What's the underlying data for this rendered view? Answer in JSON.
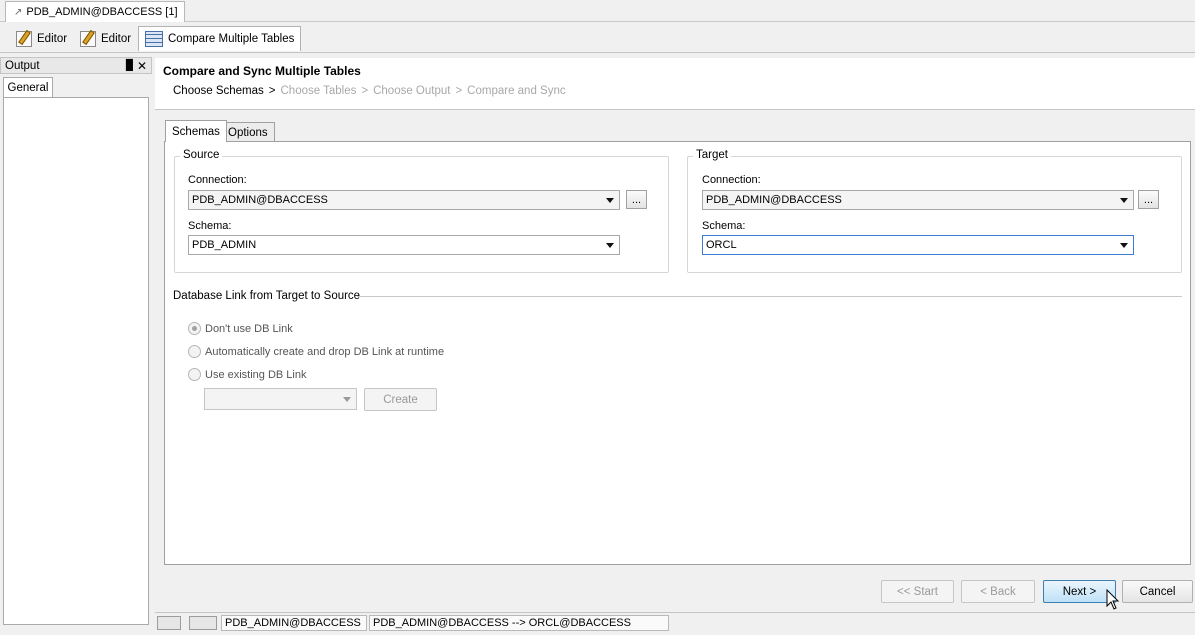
{
  "connection_tab": {
    "label": "PDB_ADMIN@DBACCESS [1]"
  },
  "editor_tabs": [
    {
      "label": "Editor",
      "icon": "edit-icon"
    },
    {
      "label": "Editor",
      "icon": "edit-icon"
    },
    {
      "label": "Compare Multiple Tables",
      "icon": "compare-tables-icon"
    }
  ],
  "output_panel": {
    "title": "Output",
    "tab": "General",
    "pin_glyph": "█",
    "close_glyph": "✕"
  },
  "wizard": {
    "title": "Compare and Sync Multiple Tables",
    "steps": [
      "Choose Schemas",
      "Choose Tables",
      "Choose Output",
      "Compare and Sync"
    ],
    "separator": ">",
    "active_step": 0
  },
  "inner_tabs": [
    "Schemas",
    "Options"
  ],
  "source": {
    "legend": "Source",
    "connection_label": "Connection:",
    "connection_value": "PDB_ADMIN@DBACCESS",
    "schema_label": "Schema:",
    "schema_value": "PDB_ADMIN",
    "dots_label": "..."
  },
  "target": {
    "legend": "Target",
    "connection_label": "Connection:",
    "connection_value": "PDB_ADMIN@DBACCESS",
    "schema_label": "Schema:",
    "schema_value": "ORCL",
    "dots_label": "..."
  },
  "db_link": {
    "legend": "Database Link from Target to Source",
    "options": [
      "Don't use DB Link",
      "Automatically create and drop DB Link at runtime",
      "Use existing DB Link"
    ],
    "selected": 0,
    "create_label": "Create"
  },
  "nav": {
    "start": "<< Start",
    "back": "< Back",
    "next": "Next >",
    "cancel": "Cancel"
  },
  "status": {
    "source": "PDB_ADMIN@DBACCESS",
    "mapping": "PDB_ADMIN@DBACCESS --> ORCL@DBACCESS"
  }
}
